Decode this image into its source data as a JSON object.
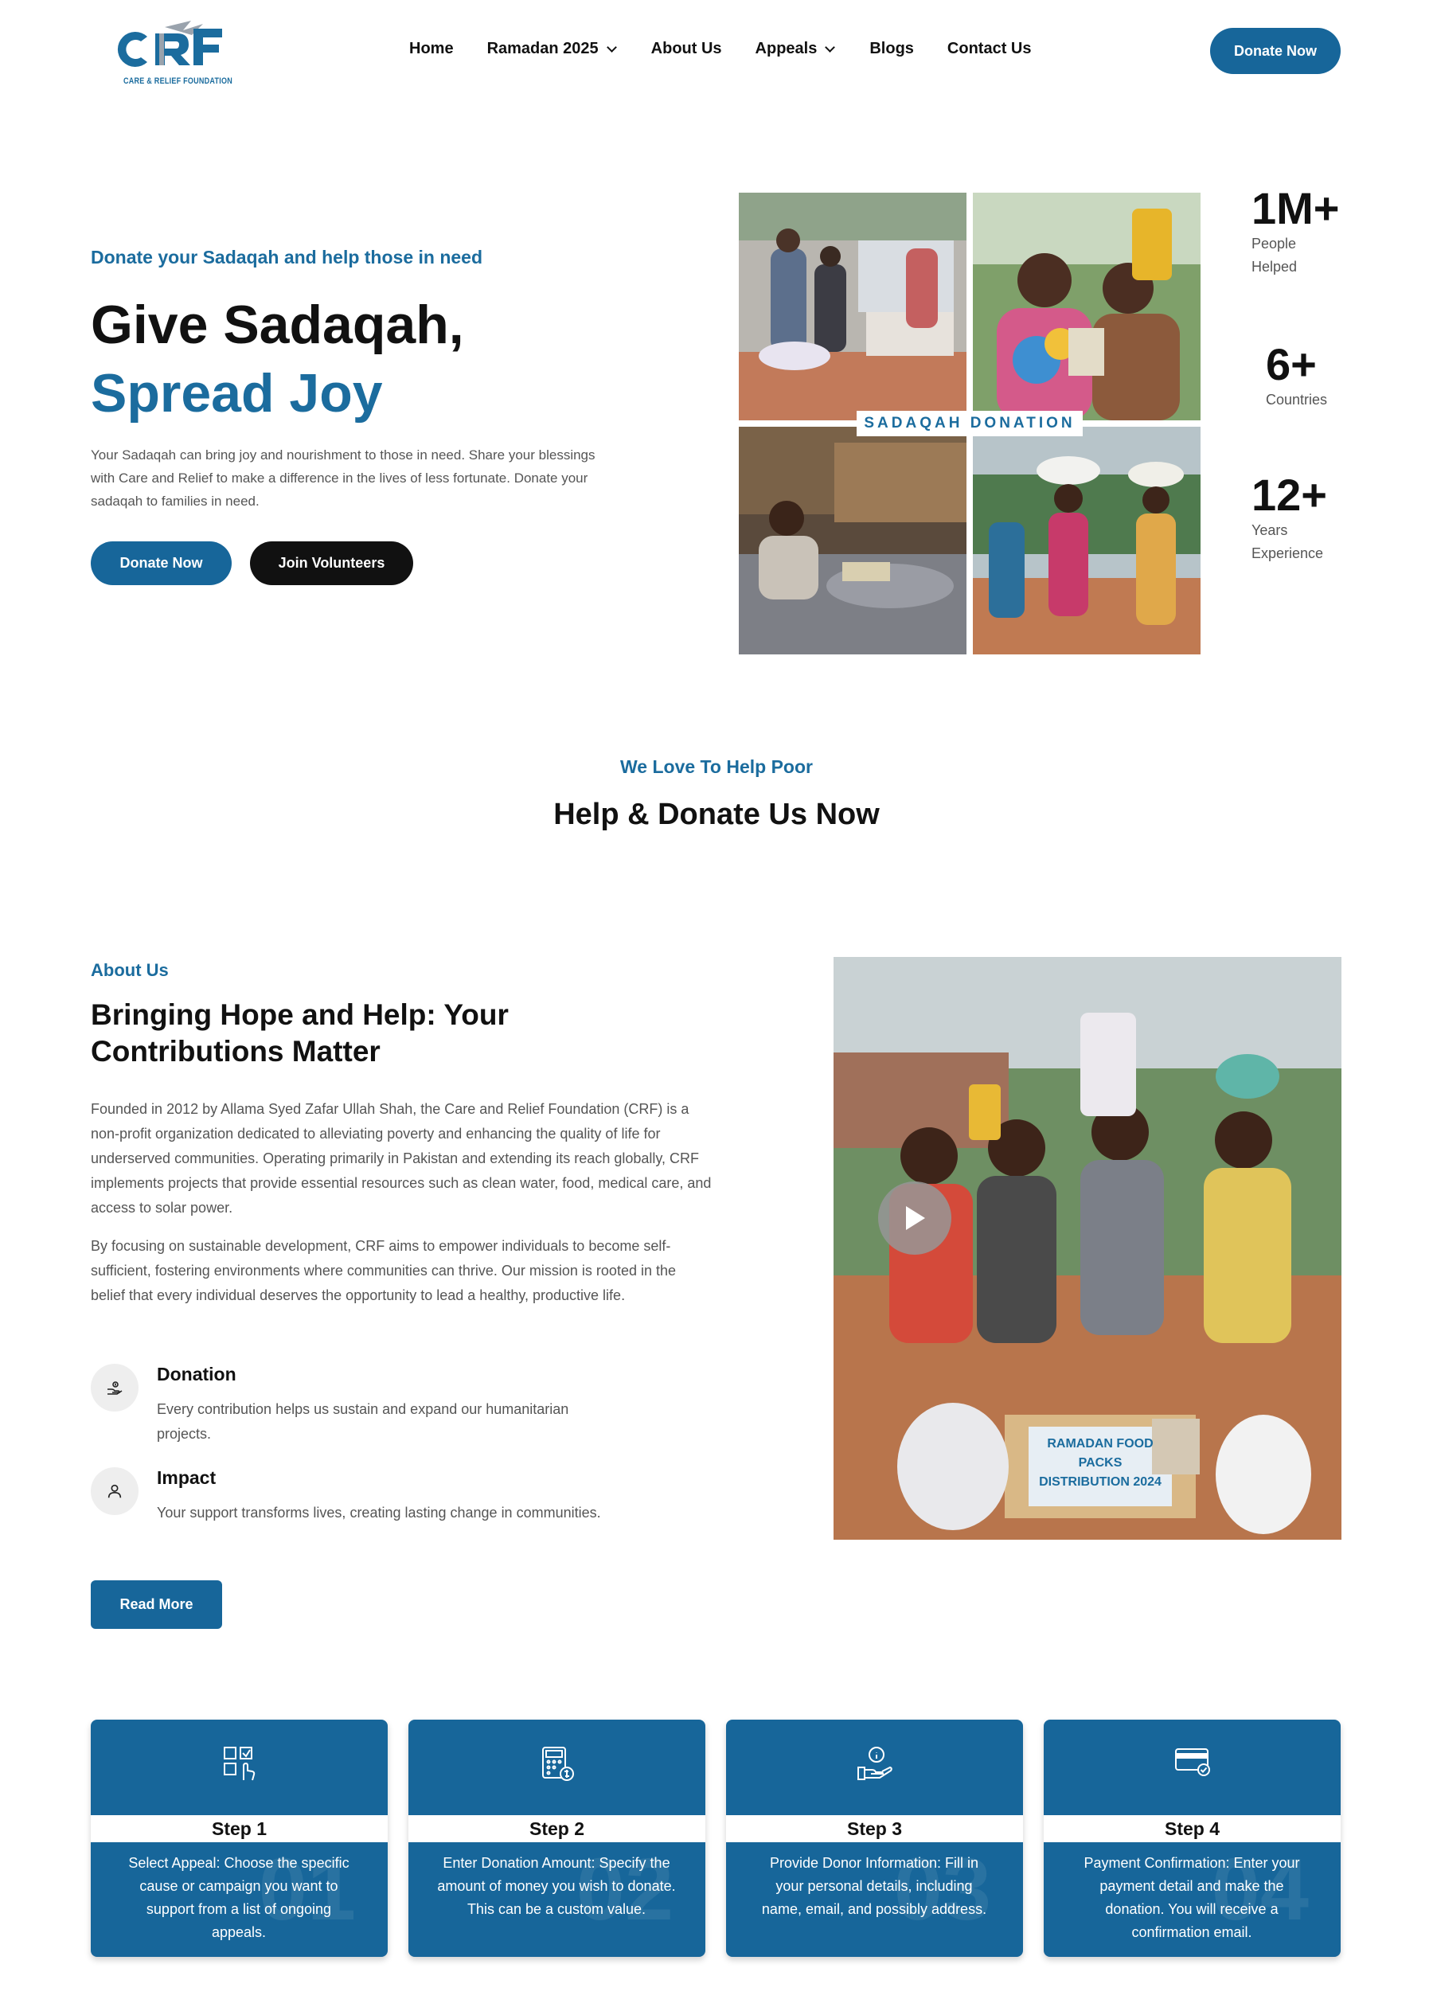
{
  "brand": {
    "logo_text": "CRF",
    "logo_tagline": "CARE & RELIEF FOUNDATION",
    "primary_color": "#17669a",
    "dark_color": "#111111"
  },
  "nav": {
    "items": [
      {
        "label": "Home",
        "has_dropdown": false
      },
      {
        "label": "Ramadan 2025",
        "has_dropdown": true
      },
      {
        "label": "About Us",
        "has_dropdown": false
      },
      {
        "label": "Appeals",
        "has_dropdown": true
      },
      {
        "label": "Blogs",
        "has_dropdown": false
      },
      {
        "label": "Contact Us",
        "has_dropdown": false
      }
    ],
    "cta_label": "Donate Now"
  },
  "hero": {
    "eyebrow": "Donate your Sadaqah and help those in need",
    "title_line1": "Give Sadaqah,",
    "title_line2": "Spread Joy",
    "description": "Your Sadaqah can bring joy and nourishment to those in need. Share your blessings with Care and Relief to make a difference in the lives of less fortunate. Donate your sadaqah to families in need.",
    "primary_button": "Donate Now",
    "secondary_button": "Join Volunteers",
    "collage_label": "SADAQAH DONATION"
  },
  "stats": [
    {
      "value": "1M+",
      "label": "People Helped"
    },
    {
      "value": "6+",
      "label": "Countries"
    },
    {
      "value": "12+",
      "label": "Years Experience"
    }
  ],
  "help": {
    "eyebrow": "We Love To Help Poor",
    "title": "Help & Donate Us Now"
  },
  "about": {
    "eyebrow": "About Us",
    "title": "Bringing Hope and Help: Your Contributions Matter",
    "paragraph1": "Founded in 2012 by Allama Syed Zafar Ullah Shah, the Care and Relief Foundation (CRF) is a non-profit organization dedicated to alleviating poverty and enhancing the quality of life for underserved communities. Operating primarily in Pakistan and extending its reach globally, CRF implements projects that provide essential resources such as clean water, food, medical care, and access to solar power.",
    "paragraph2": "By focusing on sustainable development, CRF aims to empower individuals to become self-sufficient, fostering environments where communities can thrive. Our mission is rooted in the belief that every individual deserves the opportunity to lead a healthy, productive life.",
    "features": [
      {
        "title": "Donation",
        "description": "Every contribution helps us sustain and expand our humanitarian projects.",
        "icon": "donation-hand-icon"
      },
      {
        "title": "Impact",
        "description": "Your support transforms lives, creating lasting change in communities.",
        "icon": "person-icon"
      }
    ],
    "read_more": "Read More",
    "photo_box_line1": "RAMADAN FOOD PACKS",
    "photo_box_line2": "DISTRIBUTION 2024"
  },
  "steps": [
    {
      "label": "Step 1",
      "num": "01",
      "description": "Select Appeal: Choose the specific cause or campaign you want to support from a list of ongoing appeals.",
      "icon": "select-appeal-icon"
    },
    {
      "label": "Step 2",
      "num": "02",
      "description": "Enter Donation Amount: Specify the amount of money you wish to donate. This can be a custom value.",
      "icon": "calculator-icon"
    },
    {
      "label": "Step 3",
      "num": "03",
      "description": "Provide Donor Information: Fill in your personal details, including name, email, and possibly address.",
      "icon": "donor-info-icon"
    },
    {
      "label": "Step 4",
      "num": "04",
      "description": "Payment Confirmation: Enter your payment detail and make the donation. You will receive a confirmation email.",
      "icon": "payment-card-icon"
    }
  ]
}
